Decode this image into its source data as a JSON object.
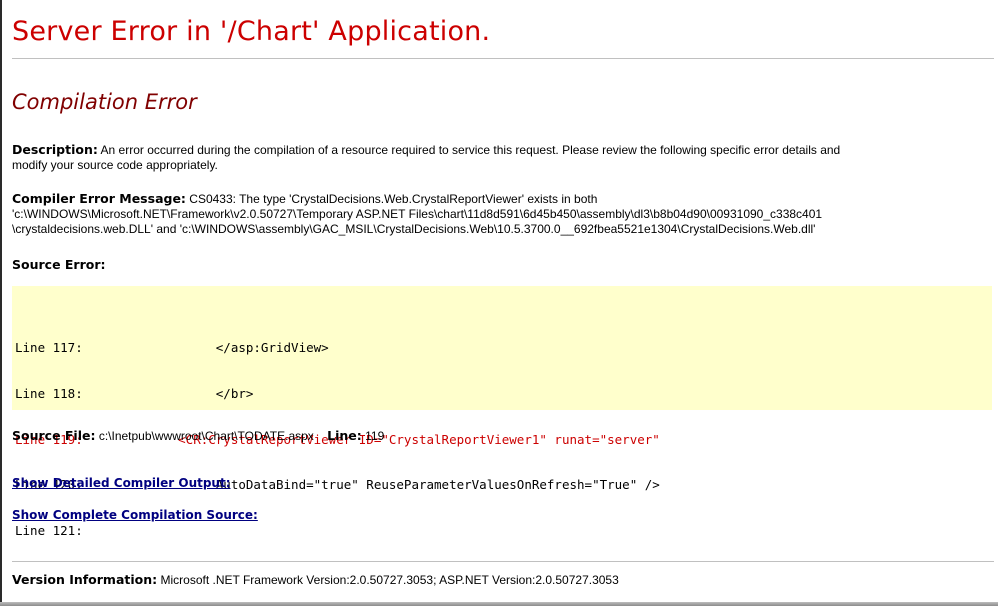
{
  "page": {
    "title": "Server Error in '/Chart' Application.",
    "subtitle": "Compilation Error"
  },
  "description": {
    "label": "Description:",
    "line1": "An error occurred during the compilation of a resource required to service this request. Please review the following specific error details and",
    "line2": "modify your source code appropriately."
  },
  "compiler_error": {
    "label": "Compiler Error Message:",
    "line1": "CS0433: The type 'CrystalDecisions.Web.CrystalReportViewer' exists in both",
    "line2": "'c:\\WINDOWS\\Microsoft.NET\\Framework\\v2.0.50727\\Temporary ASP.NET Files\\chart\\11d8d591\\6d45b450\\assembly\\dl3\\b8b04d90\\00931090_c338c401",
    "line3": "\\crystaldecisions.web.DLL' and 'c:\\WINDOWS\\assembly\\GAC_MSIL\\CrystalDecisions.Web\\10.5.3700.0__692fbea5521e1304\\CrystalDecisions.Web.dll'"
  },
  "source_error": {
    "label": "Source Error:",
    "lines": [
      {
        "number": "Line 117:",
        "code": "           </asp:GridView>"
      },
      {
        "number": "Line 118:",
        "code": "           </br>"
      },
      {
        "number": "Line 119:",
        "code": "      <CR:CrystalReportViewer ID=\"CrystalReportViewer1\" runat=\"server\""
      },
      {
        "number": "Line 120:",
        "code": "           AutoDataBind=\"true\" ReuseParameterValuesOnRefresh=\"True\" />"
      },
      {
        "number": "Line 121:",
        "code": ""
      }
    ]
  },
  "source_file": {
    "label": "Source File:",
    "value": "c:\\Inetpub\\wwwroot\\Chart\\TODATE.aspx",
    "line_label": "Line:",
    "line_value": "119"
  },
  "links": {
    "detailed_output": "Show Detailed Compiler Output:",
    "complete_source": "Show Complete Compilation Source:"
  },
  "version": {
    "label": "Version Information:",
    "value": "Microsoft .NET Framework Version:2.0.50727.3053; ASP.NET Version:2.0.50727.3053"
  },
  "colors": {
    "title": "#cc0000",
    "subtitle": "#800000",
    "code_background": "#ffffcc",
    "error_line": "#cc0000",
    "link": "#000080"
  }
}
